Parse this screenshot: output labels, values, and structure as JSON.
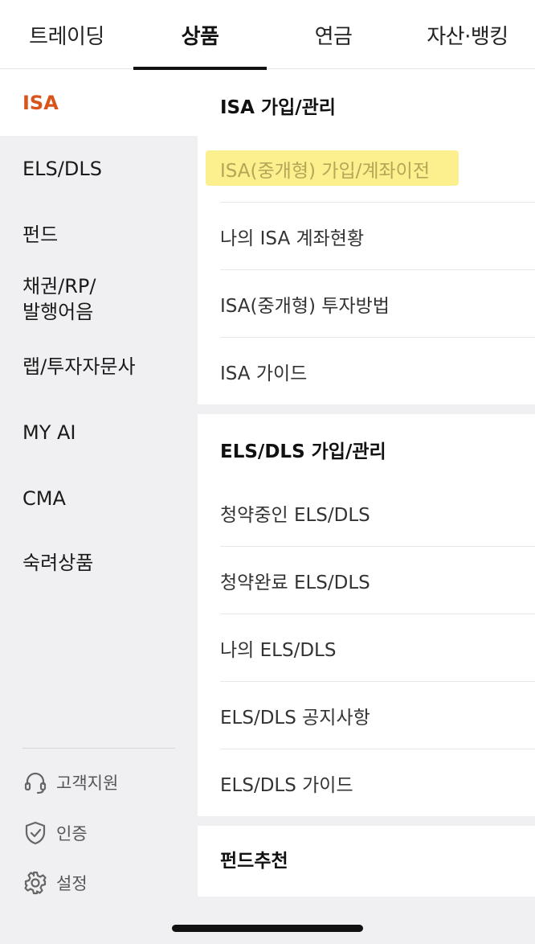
{
  "topnav": {
    "tabs": [
      "트레이딩",
      "상품",
      "연금",
      "자산·뱅킹"
    ],
    "active_index": 1
  },
  "sidebar": {
    "items": [
      {
        "label": "ISA",
        "active": true
      },
      {
        "label": "ELS/DLS"
      },
      {
        "label": "펀드"
      },
      {
        "label": "채권/RP/\n발행어음"
      },
      {
        "label": "랩/투자자문사"
      },
      {
        "label": "MY AI"
      },
      {
        "label": "CMA"
      },
      {
        "label": "숙려상품"
      }
    ],
    "utilities": [
      {
        "label": "고객지원",
        "icon": "headset-icon"
      },
      {
        "label": "인증",
        "icon": "shield-check-icon"
      },
      {
        "label": "설정",
        "icon": "gear-icon"
      }
    ]
  },
  "sections": [
    {
      "title": "ISA 가입/관리",
      "items": [
        "ISA(중개형) 가입/계좌이전",
        "나의 ISA 계좌현황",
        "ISA(중개형) 투자방법",
        "ISA 가이드"
      ]
    },
    {
      "title": "ELS/DLS 가입/관리",
      "items": [
        "청약중인 ELS/DLS",
        "청약완료 ELS/DLS",
        "나의 ELS/DLS",
        "ELS/DLS 공지사항",
        "ELS/DLS 가이드"
      ]
    },
    {
      "title": "펀드추천",
      "items": []
    }
  ],
  "colors": {
    "accent": "#d9541a",
    "highlight": "#fbef8e",
    "sidebar_bg": "#f0f0f2"
  }
}
